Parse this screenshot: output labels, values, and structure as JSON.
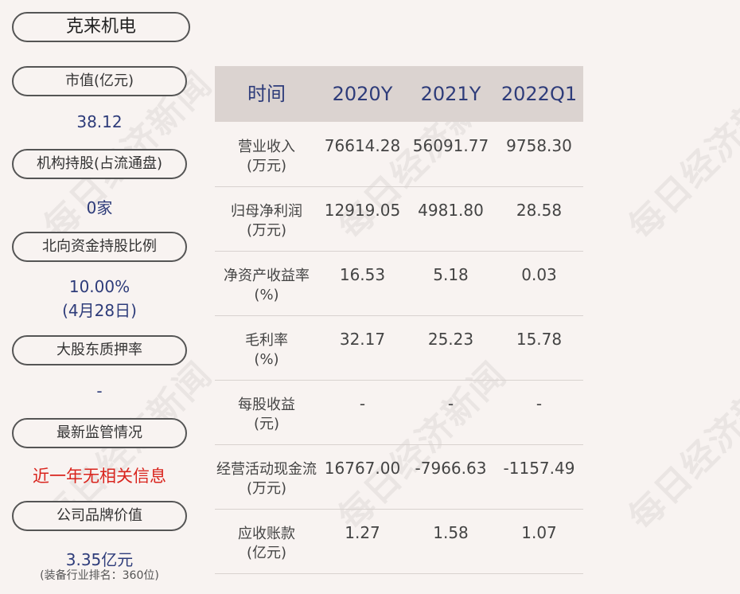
{
  "company": "克来机电",
  "watermark_text": "每日经济新闻",
  "left": {
    "market_cap_label": "市值(亿元)",
    "market_cap_value": "38.12",
    "inst_label": "机构持股(占流通盘)",
    "inst_value": "0家",
    "north_label": "北向资金持股比例",
    "north_value": "10.00%",
    "north_date": "(4月28日)",
    "pledge_label": "大股东质押率",
    "pledge_value": "-",
    "reg_label": "最新监管情况",
    "reg_value": "近一年无相关信息",
    "brand_label": "公司品牌价值",
    "brand_value": "3.35亿元",
    "brand_note": "(装备行业排名：360位)"
  },
  "table": {
    "headers": [
      "时间",
      "2020Y",
      "2021Y",
      "2022Q1"
    ],
    "rows": [
      {
        "label1": "营业收入",
        "label2": "(万元)",
        "values": [
          "76614.28",
          "56091.77",
          "9758.30"
        ]
      },
      {
        "label1": "归母净利润",
        "label2": "(万元)",
        "values": [
          "12919.05",
          "4981.80",
          "28.58"
        ]
      },
      {
        "label1": "净资产收益率",
        "label2": "(%)",
        "values": [
          "16.53",
          "5.18",
          "0.03"
        ]
      },
      {
        "label1": "毛利率",
        "label2": "(%)",
        "values": [
          "32.17",
          "25.23",
          "15.78"
        ]
      },
      {
        "label1": "每股收益",
        "label2": "(元)",
        "values": [
          "-",
          "-",
          "-"
        ]
      },
      {
        "label1": "经营活动现金流",
        "label2": "(万元)",
        "values": [
          "16767.00",
          "-7966.63",
          "-1157.49"
        ]
      },
      {
        "label1": "应收账款",
        "label2": "(亿元)",
        "values": [
          "1.27",
          "1.58",
          "1.07"
        ]
      }
    ]
  },
  "colors": {
    "background": "#f8f3f1",
    "value_blue": "#2e3c7a",
    "alert_red": "#d9241d",
    "header_bg": "#dbd3d0"
  }
}
